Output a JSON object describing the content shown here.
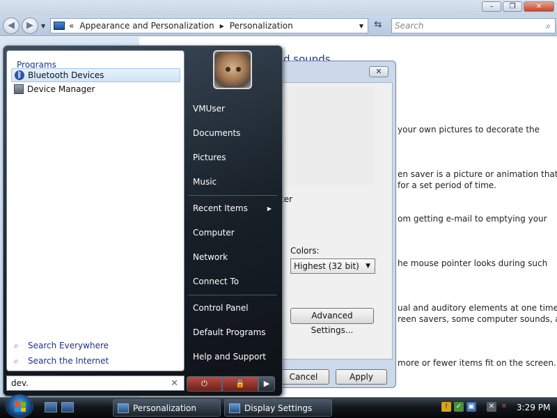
{
  "explorer": {
    "breadcrumb_prefix": "«",
    "breadcrumb": [
      "Appearance and Personalization",
      "Personalization"
    ],
    "search_placeholder": "Search",
    "heading_fragment": "d sounds",
    "bg_lines": [
      "your own pictures to decorate the",
      "en saver is a picture or animation that",
      "for a set period of time.",
      "om getting e-mail to emptying your",
      "he mouse pointer looks during such",
      "ual and auditory elements at one time",
      "reen savers, some computer sounds, and",
      "more or fewer items fit on the screen."
    ]
  },
  "dialog": {
    "close_glyph": "✕",
    "fragment": "ter",
    "colors_label": "Colors:",
    "colors_value": "Highest (32 bit)",
    "advanced_label": "Advanced Settings...",
    "cancel_label": "Cancel",
    "apply_label": "Apply"
  },
  "start_menu": {
    "programs_label": "Programs",
    "programs": [
      {
        "label": "Bluetooth Devices",
        "icon": "bluetooth-icon"
      },
      {
        "label": "Device Manager",
        "icon": "device-manager-icon"
      }
    ],
    "search_everywhere": "Search Everywhere",
    "search_internet": "Search the Internet",
    "search_value": "dev.",
    "right_items": {
      "user": "VMUser",
      "documents": "Documents",
      "pictures": "Pictures",
      "music": "Music",
      "recent_items": "Recent Items",
      "computer": "Computer",
      "network": "Network",
      "connect_to": "Connect To",
      "control_panel": "Control Panel",
      "default_programs": "Default Programs",
      "help_support": "Help and Support"
    }
  },
  "taskbar": {
    "buttons": [
      "Personalization",
      "Display Settings"
    ],
    "clock": "3:29 PM"
  },
  "colors": {
    "link_blue": "#1e3287",
    "start_menu_dark": "#182028",
    "taskbar_dark": "#12171c"
  }
}
